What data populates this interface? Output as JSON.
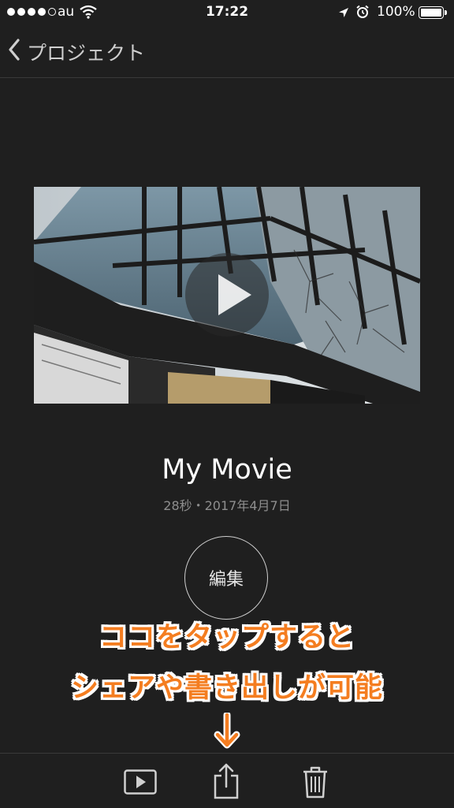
{
  "status_bar": {
    "carrier": "au",
    "time": "17:22",
    "battery_percent": "100%",
    "signal_bars": 4,
    "icons": [
      "wifi-icon",
      "location-arrow-icon",
      "alarm-icon",
      "battery-icon"
    ]
  },
  "nav": {
    "back_label": "プロジェクト",
    "back_icon": "chevron-left-icon"
  },
  "movie": {
    "title": "My Movie",
    "meta": "28秒・2017年4月7日"
  },
  "edit_button": {
    "label": "編集"
  },
  "annotation": {
    "line1": "ココをタップすると",
    "line2": "シェアや書き出しが可能",
    "arrow_icon": "down-arrow-icon",
    "color": "#f47d20"
  },
  "toolbar": {
    "items": [
      "play-icon",
      "share-icon",
      "trash-icon"
    ]
  },
  "colors": {
    "background": "#1f1f1f",
    "divider": "#3a3a3a",
    "secondary_text": "#8e8e8e"
  }
}
